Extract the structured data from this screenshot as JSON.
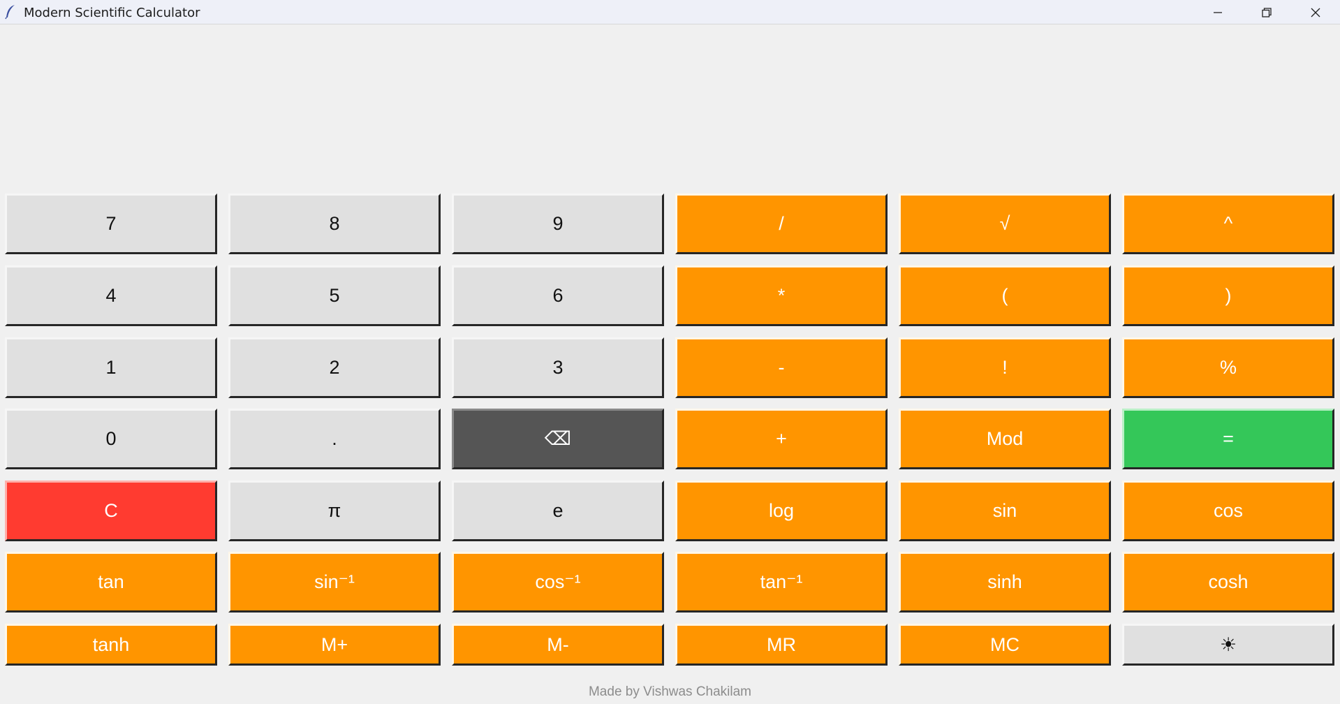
{
  "window": {
    "title": "Modern Scientific Calculator",
    "icon": "feather-icon",
    "controls": [
      "minimize-icon",
      "restore-icon",
      "close-icon"
    ]
  },
  "display": {
    "value": ""
  },
  "colors": {
    "number_key": "#e0e0e0",
    "operator_key": "#ff9500",
    "backspace_key": "#555555",
    "equals_key": "#34c759",
    "clear_key": "#ff3b30",
    "background": "#f0f0f0"
  },
  "keys": {
    "r0": [
      "7",
      "8",
      "9",
      "/",
      "√",
      "^"
    ],
    "r1": [
      "4",
      "5",
      "6",
      "*",
      "(",
      ")"
    ],
    "r2": [
      "1",
      "2",
      "3",
      "-",
      "!",
      "%"
    ],
    "r3": [
      "0",
      ".",
      "⌫",
      "+",
      "Mod",
      "="
    ],
    "r4": [
      "C",
      "π",
      "e",
      "log",
      "sin",
      "cos"
    ],
    "r5": [
      "tan",
      "sin⁻¹",
      "cos⁻¹",
      "tan⁻¹",
      "sinh",
      "cosh"
    ],
    "r6": [
      "tanh",
      "M+",
      "M-",
      "MR",
      "MC",
      "☀"
    ]
  },
  "footer": {
    "credit": "Made by Vishwas Chakilam"
  }
}
